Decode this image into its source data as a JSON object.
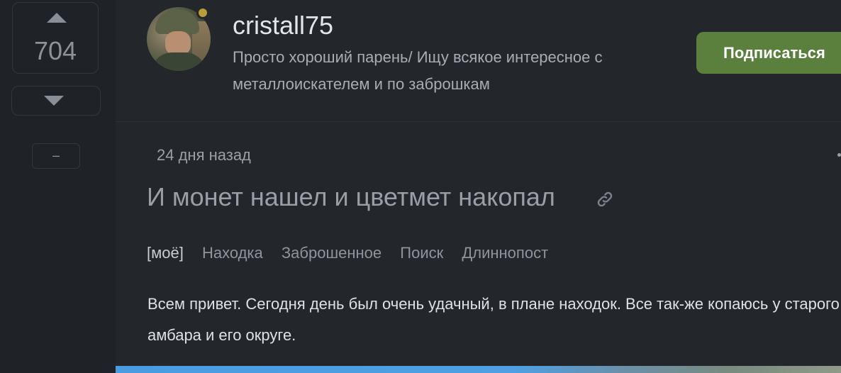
{
  "votes": {
    "count": "704",
    "collapse_label": "–"
  },
  "author": {
    "username": "cristall75",
    "bio": "Просто хороший парень/ Ищу всякое интересное с металлоискателем и по заброшкам",
    "status_color": "#b89e3a"
  },
  "actions": {
    "subscribe_label": "Подписаться",
    "subscribe_color": "#5b7f3d"
  },
  "post": {
    "date": "24 дня назад",
    "title": "И монет нашел и цветмет накопал",
    "tags": [
      "[моё]",
      "Находка",
      "Заброшенное",
      "Поиск",
      "Длиннопост"
    ],
    "body": "Всем привет. Сегодня день был очень удачный, в плане находок. Все так-же копаюсь у старого амбара и его округе."
  },
  "icons": {
    "link": "link-icon",
    "upvote": "arrow-up-icon",
    "downvote": "arrow-down-icon",
    "more": "more-dots-icon"
  }
}
